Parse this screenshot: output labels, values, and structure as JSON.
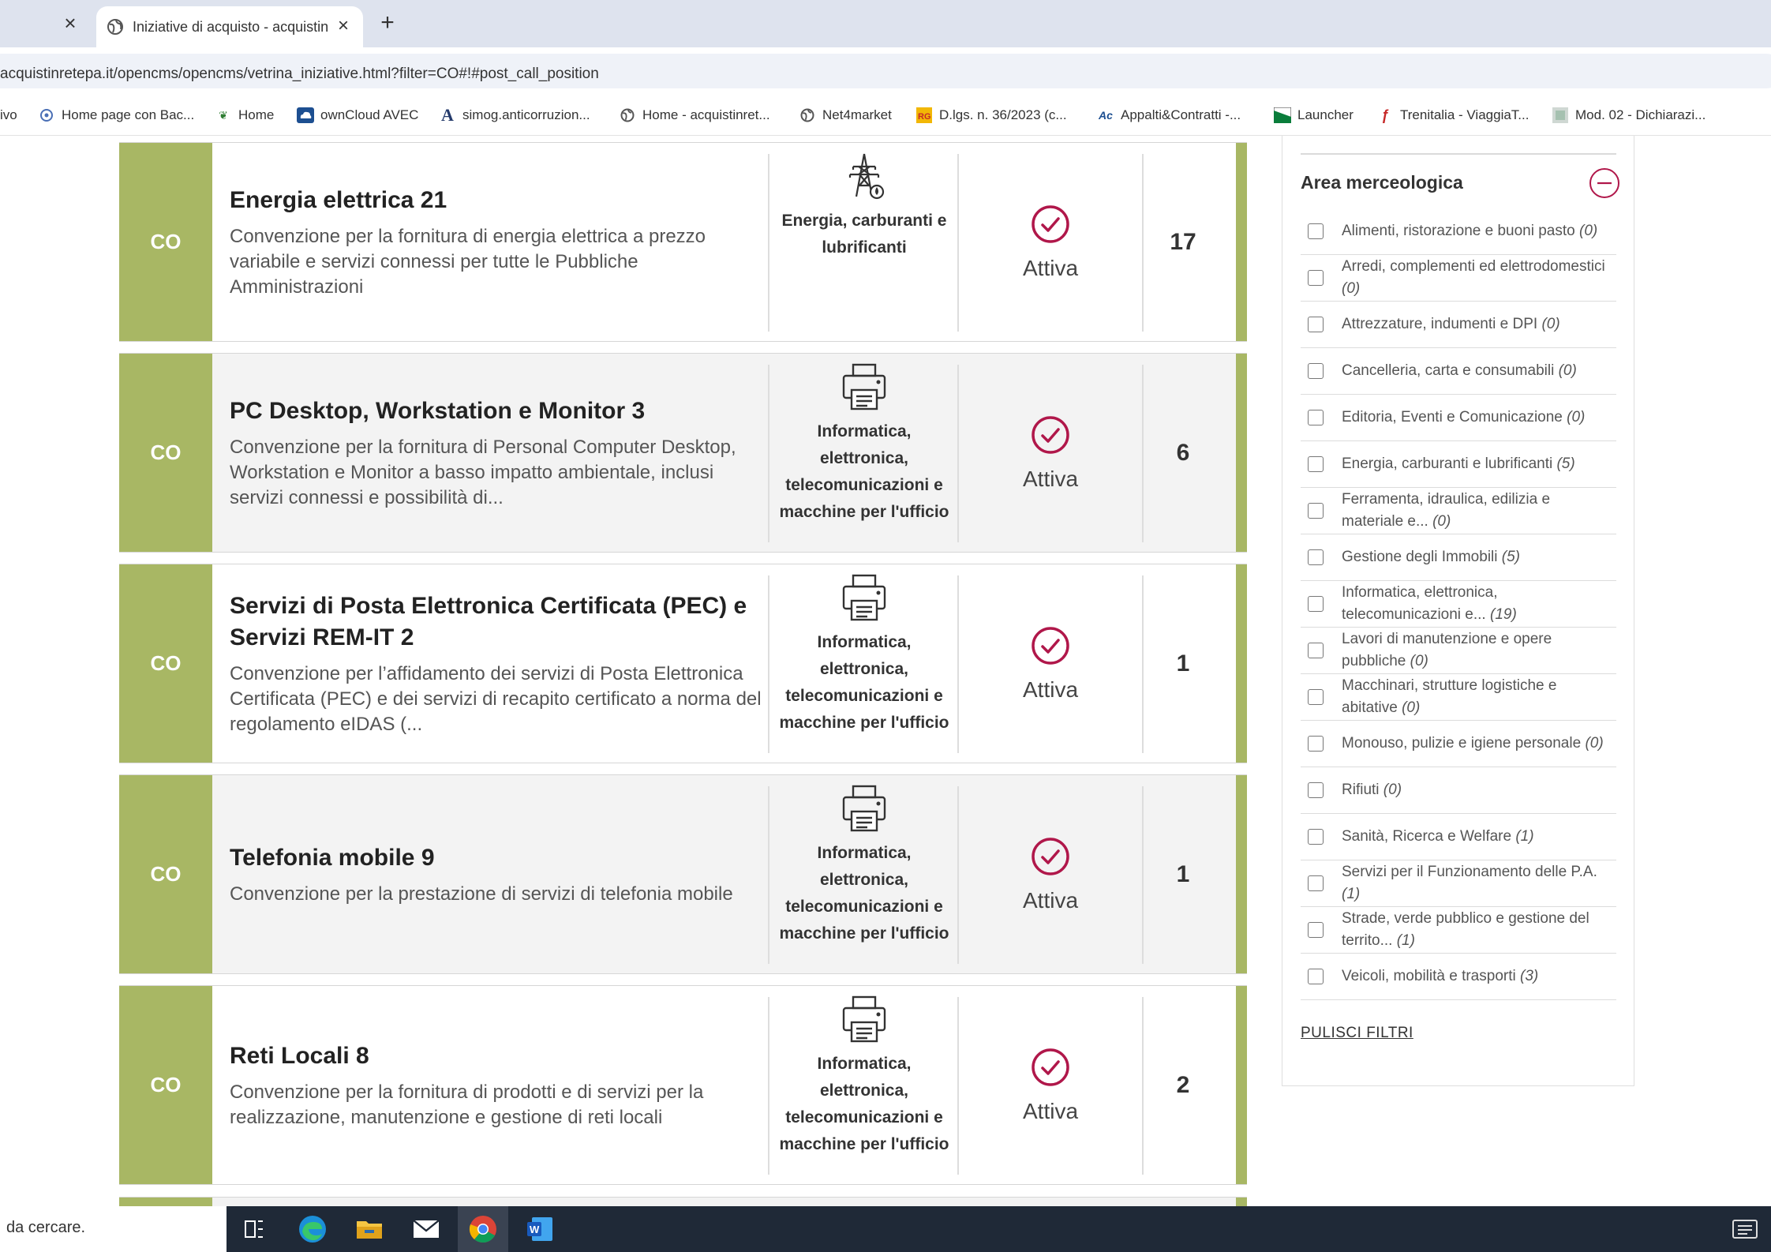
{
  "browser": {
    "active_tab_title": "Iniziative di acquisto - acquistin",
    "url": "acquistinretepa.it/opencms/opencms/vetrina_iniziative.html?filter=CO#!#post_call_position",
    "bookmarks": [
      {
        "label": "ivo",
        "icon": ""
      },
      {
        "label": "Home page con Bac...",
        "icon": "gear-globe-icon"
      },
      {
        "label": "Home",
        "icon": "leaf-icon"
      },
      {
        "label": "ownCloud AVEC",
        "icon": "cloud-icon"
      },
      {
        "label": "simog.anticorruzion...",
        "icon": "letter-a-icon"
      },
      {
        "label": "Home - acquistinret...",
        "icon": "globe-icon"
      },
      {
        "label": "Net4market",
        "icon": "globe-icon"
      },
      {
        "label": "D.lgs. n. 36/2023 (c...",
        "icon": "badge-icon"
      },
      {
        "label": "Appalti&Contratti -...",
        "icon": "ac-icon"
      },
      {
        "label": "Launcher",
        "icon": "flag-icon"
      },
      {
        "label": "Trenitalia - ViaggiaT...",
        "icon": "train-icon"
      },
      {
        "label": "Mod. 02 - Dichiarazi...",
        "icon": "doc-icon"
      }
    ]
  },
  "initiatives": [
    {
      "code": "CO",
      "title": "Energia elettrica 21",
      "description": "Convenzione per la fornitura di energia elettrica a prezzo variabile e servizi connessi per tutte le Pubbliche Amministrazioni",
      "category": "Energia, carburanti e lubrificanti",
      "category_icon": "power-pylon-icon",
      "status": "Attiva",
      "count": "17"
    },
    {
      "code": "CO",
      "title": "PC Desktop, Workstation e Monitor 3",
      "description": "Convenzione per la fornitura di Personal Computer Desktop, Workstation e Monitor a basso impatto ambientale, inclusi servizi connessi e possibilità di...",
      "category": "Informatica, elettronica, telecomunicazioni e macchine per l'ufficio",
      "category_icon": "printer-icon",
      "status": "Attiva",
      "count": "6"
    },
    {
      "code": "CO",
      "title": "Servizi di Posta Elettronica Certificata (PEC) e Servizi REM-IT 2",
      "description": "Convenzione per l’affidamento dei servizi di Posta Elettronica Certificata (PEC) e dei servizi di recapito certificato a norma del regolamento eIDAS (...",
      "category": "Informatica, elettronica, telecomunicazioni e macchine per l'ufficio",
      "category_icon": "printer-icon",
      "status": "Attiva",
      "count": "1"
    },
    {
      "code": "CO",
      "title": "Telefonia mobile 9",
      "description": "Convenzione per la prestazione di servizi di telefonia mobile",
      "category": "Informatica, elettronica, telecomunicazioni e macchine per l'ufficio",
      "category_icon": "printer-icon",
      "status": "Attiva",
      "count": "1"
    },
    {
      "code": "CO",
      "title": "Reti Locali 8",
      "description": "Convenzione per la fornitura di prodotti e di servizi per la realizzazione, manutenzione e gestione di reti locali",
      "category": "Informatica, elettronica, telecomunicazioni e macchine per l'ufficio",
      "category_icon": "printer-icon",
      "status": "Attiva",
      "count": "2"
    }
  ],
  "sidebar": {
    "title": "Area merceologica",
    "filters": [
      {
        "label": "Alimenti, ristorazione e buoni pasto",
        "count": "(0)"
      },
      {
        "label": "Arredi, complementi ed elettrodomestici",
        "count": "(0)"
      },
      {
        "label": "Attrezzature, indumenti e DPI",
        "count": "(0)"
      },
      {
        "label": "Cancelleria, carta e consumabili",
        "count": "(0)"
      },
      {
        "label": "Editoria, Eventi e Comunicazione",
        "count": "(0)"
      },
      {
        "label": "Energia, carburanti e lubrificanti",
        "count": "(5)"
      },
      {
        "label": "Ferramenta, idraulica, edilizia e materiale e...",
        "count": "(0)"
      },
      {
        "label": "Gestione degli Immobili",
        "count": "(5)"
      },
      {
        "label": "Informatica, elettronica, telecomunicazioni e...",
        "count": "(19)"
      },
      {
        "label": "Lavori di manutenzione e opere pubbliche",
        "count": "(0)"
      },
      {
        "label": "Macchinari, strutture logistiche e abitative",
        "count": "(0)"
      },
      {
        "label": "Monouso, pulizie e igiene personale",
        "count": "(0)"
      },
      {
        "label": "Rifiuti",
        "count": "(0)"
      },
      {
        "label": "Sanità, Ricerca e Welfare",
        "count": "(1)"
      },
      {
        "label": "Servizi per il Funzionamento delle P.A.",
        "count": "(1)"
      },
      {
        "label": "Strade, verde pubblico e gestione del territo...",
        "count": "(1)"
      },
      {
        "label": "Veicoli, mobilità e trasporti",
        "count": "(3)"
      }
    ],
    "clear_label": "PULISCI FILTRI"
  },
  "taskbar": {
    "search_text": "da cercare.",
    "apps": [
      "task-view-icon",
      "edge-icon",
      "file-explorer-icon",
      "mail-icon",
      "chrome-icon",
      "word-icon"
    ]
  },
  "colors": {
    "accent_green": "#a8b764",
    "status_red": "#b0174a",
    "chrome_bg": "#dee3ee",
    "taskbar_bg": "#1f2937"
  }
}
